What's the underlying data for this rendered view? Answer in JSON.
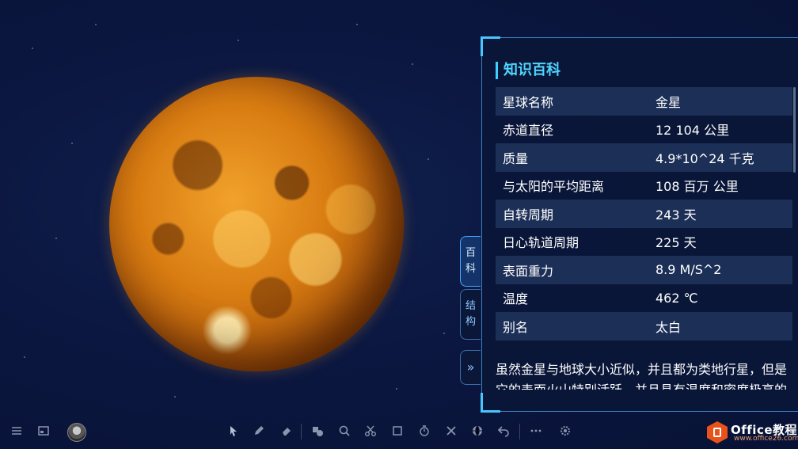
{
  "panel": {
    "title": "知识百科",
    "rows": [
      {
        "label": "星球名称",
        "value": "金星"
      },
      {
        "label": "赤道直径",
        "value": "12 104 公里"
      },
      {
        "label": "质量",
        "value": "4.9*10^24 千克"
      },
      {
        "label": "与太阳的平均距离",
        "value": "108 百万 公里"
      },
      {
        "label": "自转周期",
        "value": "243 天"
      },
      {
        "label": "日心轨道周期",
        "value": "225 天"
      },
      {
        "label": "表面重力",
        "value": "8.9 M/S^2"
      },
      {
        "label": "温度",
        "value": "462 ℃"
      },
      {
        "label": "别名",
        "value": "太白"
      }
    ],
    "description": "虽然金星与地球大小近似，并且都为类地行星，但是它的表面火山特别活跃，并且具有温度和密度极高的"
  },
  "side_tabs": {
    "baike_1": "百",
    "baike_2": "科",
    "jiegou_1": "结",
    "jiegou_2": "构",
    "collapse": "»"
  },
  "logo": {
    "name": "Office教程网",
    "url": "www.office26.com"
  },
  "icons": {
    "menu": "menu-icon",
    "layout": "layout-icon",
    "avatar": "avatar",
    "pointer": "pointer-icon",
    "pen": "pen-icon",
    "eraser": "eraser-icon",
    "shapes": "shapes-icon",
    "search": "magnifier-icon",
    "scissors": "scissors-icon",
    "square": "square-icon",
    "timer": "timer-icon",
    "tools": "tools-icon",
    "globe": "globe-icon",
    "undo": "undo-icon",
    "more": "more-icon",
    "settings": "settings-icon"
  },
  "colors": {
    "accent": "#4fd6ff",
    "panel_bg": "#0a1638",
    "background": "#0b1740"
  }
}
